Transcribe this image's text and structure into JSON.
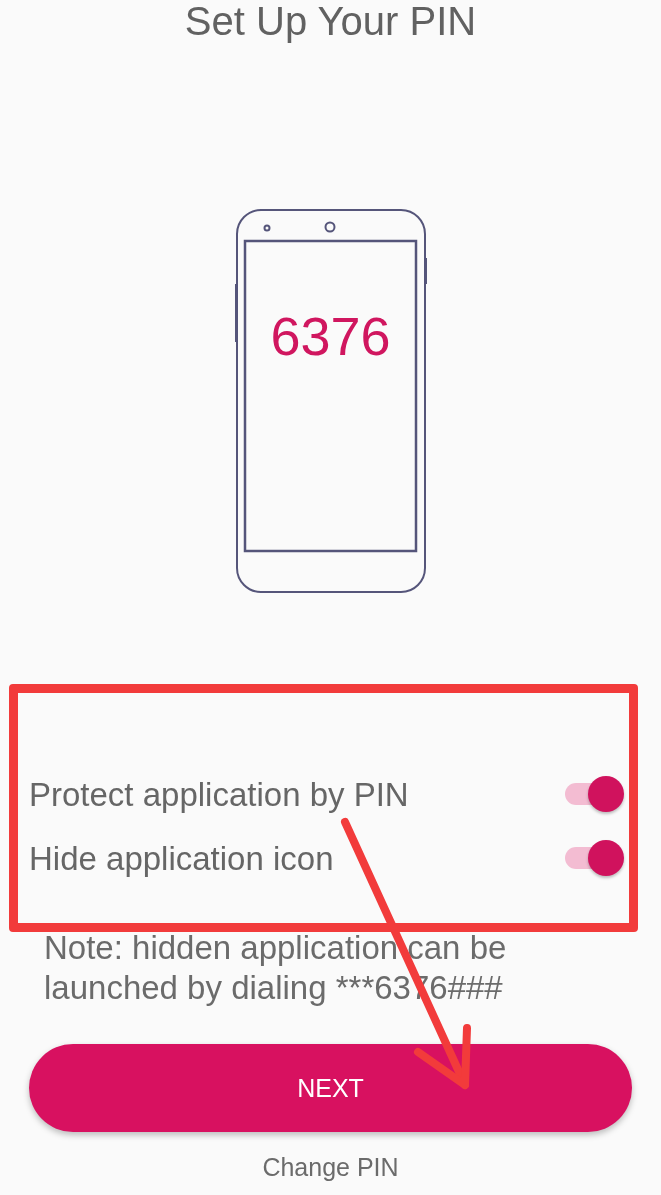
{
  "title": "Set Up Your PIN",
  "illustration": {
    "pin": "6376"
  },
  "options": [
    {
      "label": "Protect application by PIN",
      "on": true
    },
    {
      "label": "Hide application icon",
      "on": true
    }
  ],
  "note": "Note: hidden application can be launched by dialing ***6376###",
  "actions": {
    "primary": "NEXT",
    "secondary": "Change PIN"
  }
}
